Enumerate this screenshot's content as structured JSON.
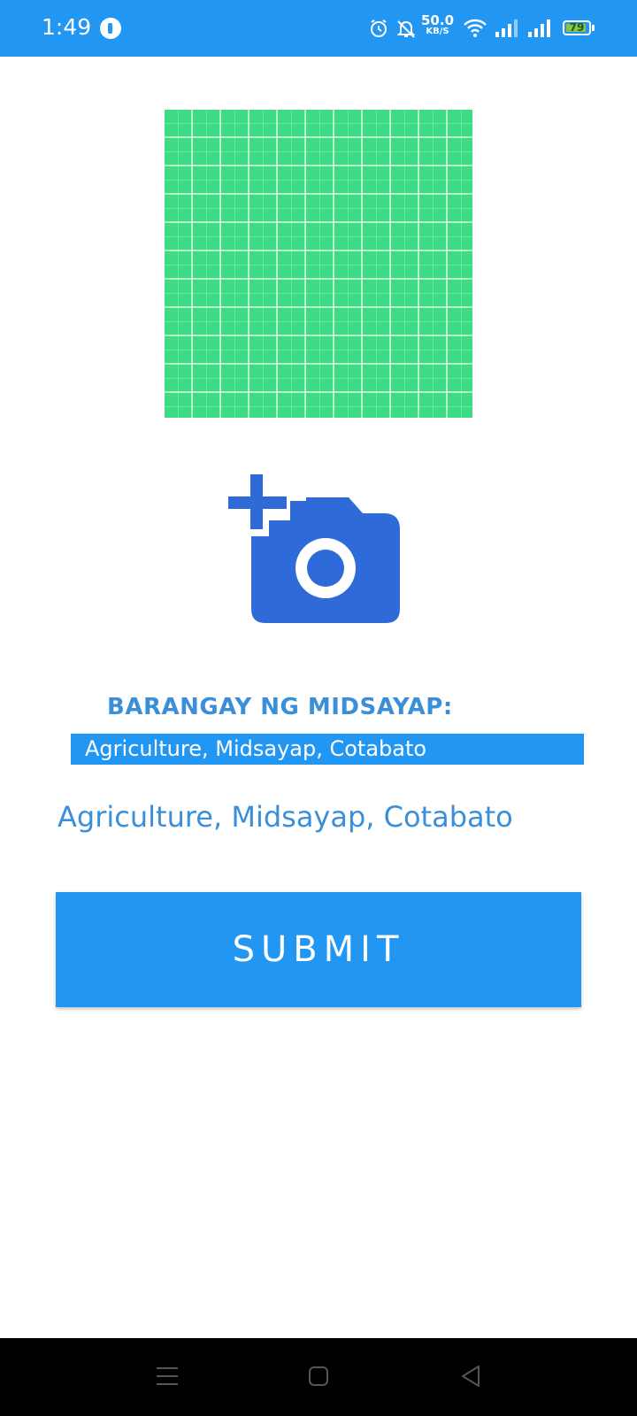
{
  "status_bar": {
    "time": "1:49",
    "network_speed_value": "50.0",
    "network_speed_unit": "KB/S",
    "battery_level": "79",
    "icons": [
      "app-notification-icon",
      "alarm-icon",
      "mute-icon",
      "wifi-icon",
      "signal-icon",
      "signal-icon",
      "battery-icon"
    ]
  },
  "form": {
    "barangay_label": "BARANGAY NG MIDSAYAP:",
    "selected_location": "Agriculture, Midsayap, Cotabato",
    "location_display": "Agriculture, Midsayap, Cotabato",
    "submit_label": "SUBMIT"
  },
  "nav_bar": {
    "icons": [
      "menu-icon",
      "home-icon",
      "back-icon"
    ]
  },
  "colors": {
    "primary": "#2196f3",
    "accent_text": "#3a8fd8",
    "preview_green": "#3ddc84",
    "camera_blue": "#2f6bd8"
  }
}
